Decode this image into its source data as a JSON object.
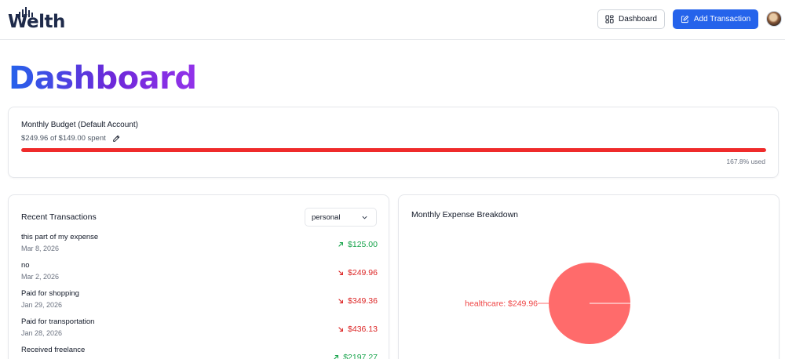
{
  "header": {
    "logo_text": "Welth",
    "dashboard_button": "Dashboard",
    "add_transaction_button": "Add Transaction"
  },
  "page_title": "Dashboard",
  "budget": {
    "title": "Monthly Budget (Default Account)",
    "spent_text": "$249.96 of $149.00 spent",
    "used_text": "167.8% used",
    "used_fraction": 1.0,
    "bar_color": "#ef2b2b"
  },
  "transactions": {
    "title": "Recent Transactions",
    "account_selected": "personal",
    "items": [
      {
        "description": "this part of my expense",
        "date": "Mar 8, 2026",
        "amount": "$125.00",
        "type": "income"
      },
      {
        "description": "no",
        "date": "Mar 2, 2026",
        "amount": "$249.96",
        "type": "expense"
      },
      {
        "description": "Paid for shopping",
        "date": "Jan 29, 2026",
        "amount": "$349.36",
        "type": "expense"
      },
      {
        "description": "Paid for transportation",
        "date": "Jan 28, 2026",
        "amount": "$436.13",
        "type": "expense"
      },
      {
        "description": "Received freelance",
        "date": "",
        "amount": "$2197.27",
        "type": "income"
      }
    ]
  },
  "breakdown": {
    "title": "Monthly Expense Breakdown"
  },
  "chart_data": {
    "type": "pie",
    "title": "",
    "slices": [
      {
        "label": "healthcare: $249.96",
        "category": "healthcare",
        "value": 249.96,
        "color": "#ff6b6b"
      }
    ]
  },
  "colors": {
    "primary": "#2563eb",
    "income": "#16a34a",
    "expense": "#dc2626"
  }
}
